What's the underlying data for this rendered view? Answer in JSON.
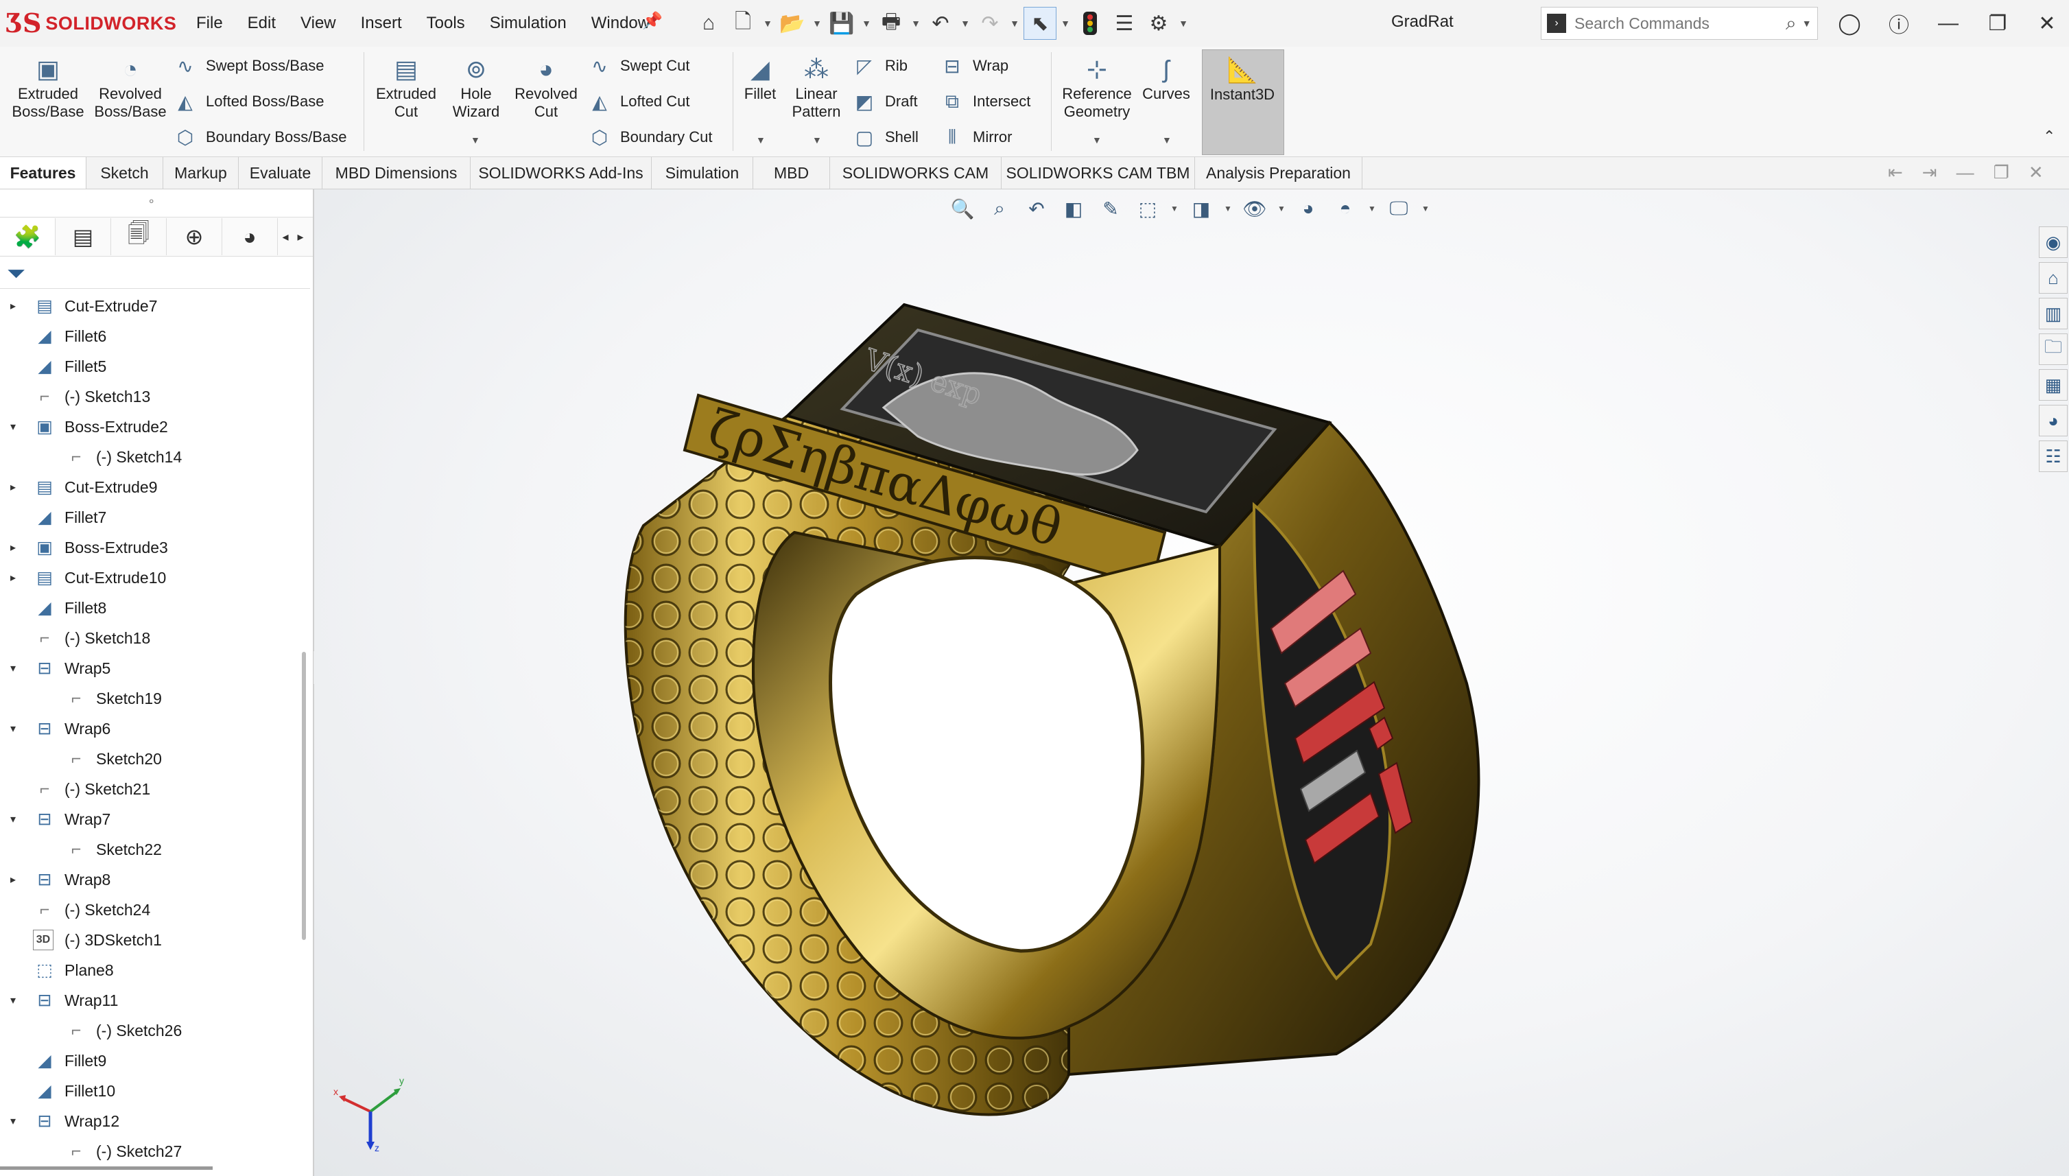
{
  "app": {
    "logo_mark": "ƷS",
    "logo_text": "SOLIDWORKS",
    "document_title": "GradRat"
  },
  "menu": [
    "File",
    "Edit",
    "View",
    "Insert",
    "Tools",
    "Simulation",
    "Window"
  ],
  "quick_access_icons": [
    "home-icon",
    "new-document-icon",
    "open-folder-icon",
    "save-icon",
    "print-icon",
    "undo-icon",
    "redo-icon",
    "select-pointer-icon",
    "rebuild-traffic-light-icon",
    "file-properties-icon",
    "options-gear-icon"
  ],
  "search": {
    "placeholder": "Search Commands"
  },
  "ribbon": {
    "extruded_boss": "Extruded Boss/Base",
    "revolved_boss": "Revolved Boss/Base",
    "swept_boss": "Swept Boss/Base",
    "lofted_boss": "Lofted Boss/Base",
    "boundary_boss": "Boundary Boss/Base",
    "extruded_cut": "Extruded Cut",
    "hole_wizard": "Hole Wizard",
    "revolved_cut": "Revolved Cut",
    "swept_cut": "Swept Cut",
    "lofted_cut": "Lofted Cut",
    "boundary_cut": "Boundary Cut",
    "fillet": "Fillet",
    "linear_pattern": "Linear Pattern",
    "rib": "Rib",
    "draft": "Draft",
    "shell": "Shell",
    "wrap": "Wrap",
    "intersect": "Intersect",
    "mirror": "Mirror",
    "reference_geometry": "Reference Geometry",
    "curves": "Curves",
    "instant3d": "Instant3D"
  },
  "tabs": [
    "Features",
    "Sketch",
    "Markup",
    "Evaluate",
    "MBD Dimensions",
    "SOLIDWORKS Add-Ins",
    "Simulation",
    "MBD",
    "SOLIDWORKS CAM",
    "SOLIDWORKS CAM TBM",
    "Analysis Preparation"
  ],
  "active_tab": "Features",
  "feature_tree": [
    {
      "label": "Cut-Extrude7",
      "icon": "cut-extrude-icon",
      "indent": 0,
      "expander": "collapsed"
    },
    {
      "label": "Fillet6",
      "icon": "fillet-icon",
      "indent": 0,
      "expander": "none"
    },
    {
      "label": "Fillet5",
      "icon": "fillet-icon",
      "indent": 0,
      "expander": "none"
    },
    {
      "label": "(-) Sketch13",
      "icon": "sketch-icon",
      "indent": 0,
      "expander": "none"
    },
    {
      "label": "Boss-Extrude2",
      "icon": "boss-extrude-icon",
      "indent": 0,
      "expander": "expanded"
    },
    {
      "label": "(-) Sketch14",
      "icon": "sketch-icon",
      "indent": 1,
      "expander": "none"
    },
    {
      "label": "Cut-Extrude9",
      "icon": "cut-extrude-icon",
      "indent": 0,
      "expander": "collapsed"
    },
    {
      "label": "Fillet7",
      "icon": "fillet-icon",
      "indent": 0,
      "expander": "none"
    },
    {
      "label": "Boss-Extrude3",
      "icon": "boss-extrude-icon",
      "indent": 0,
      "expander": "collapsed"
    },
    {
      "label": "Cut-Extrude10",
      "icon": "cut-extrude-icon",
      "indent": 0,
      "expander": "collapsed"
    },
    {
      "label": "Fillet8",
      "icon": "fillet-icon",
      "indent": 0,
      "expander": "none"
    },
    {
      "label": "(-) Sketch18",
      "icon": "sketch-icon",
      "indent": 0,
      "expander": "none"
    },
    {
      "label": "Wrap5",
      "icon": "wrap-icon",
      "indent": 0,
      "expander": "expanded"
    },
    {
      "label": "Sketch19",
      "icon": "sketch-icon",
      "indent": 1,
      "expander": "none"
    },
    {
      "label": "Wrap6",
      "icon": "wrap-icon",
      "indent": 0,
      "expander": "expanded"
    },
    {
      "label": "Sketch20",
      "icon": "sketch-icon",
      "indent": 1,
      "expander": "none"
    },
    {
      "label": "(-) Sketch21",
      "icon": "sketch-icon",
      "indent": 0,
      "expander": "none"
    },
    {
      "label": "Wrap7",
      "icon": "wrap-icon",
      "indent": 0,
      "expander": "expanded"
    },
    {
      "label": "Sketch22",
      "icon": "sketch-icon",
      "indent": 1,
      "expander": "none"
    },
    {
      "label": "Wrap8",
      "icon": "wrap-icon",
      "indent": 0,
      "expander": "collapsed"
    },
    {
      "label": "(-) Sketch24",
      "icon": "sketch-icon",
      "indent": 0,
      "expander": "none"
    },
    {
      "label": "(-) 3DSketch1",
      "icon": "3d-sketch-icon",
      "indent": 0,
      "expander": "none"
    },
    {
      "label": "Plane8",
      "icon": "plane-icon",
      "indent": 0,
      "expander": "none"
    },
    {
      "label": "Wrap11",
      "icon": "wrap-icon",
      "indent": 0,
      "expander": "expanded"
    },
    {
      "label": "(-) Sketch26",
      "icon": "sketch-icon",
      "indent": 1,
      "expander": "none"
    },
    {
      "label": "Fillet9",
      "icon": "fillet-icon",
      "indent": 0,
      "expander": "none"
    },
    {
      "label": "Fillet10",
      "icon": "fillet-icon",
      "indent": 0,
      "expander": "none"
    },
    {
      "label": "Wrap12",
      "icon": "wrap-icon",
      "indent": 0,
      "expander": "expanded"
    },
    {
      "label": "(-) Sketch27",
      "icon": "sketch-icon",
      "indent": 1,
      "expander": "none"
    }
  ],
  "model": {
    "engraving_greek": "ζρΣηβπαΔφωθ",
    "bezel_text": "V(x) exp",
    "colors": {
      "gold_light": "#f0d878",
      "gold_mid": "#b89428",
      "gold_dark": "#5a4610",
      "shank_dark": "#1e1808",
      "bezel_inset": "#242424",
      "stripe_red": "#c83a3a",
      "stripe_pink": "#e07a7a",
      "stripe_gray": "#a8a8a8"
    }
  },
  "triad_axes": [
    "x",
    "y",
    "z"
  ]
}
